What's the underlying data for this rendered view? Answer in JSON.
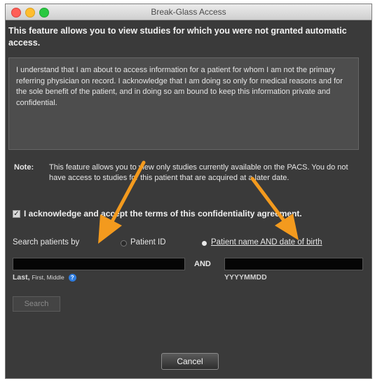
{
  "window": {
    "title": "Break-Glass Access"
  },
  "header": {
    "text": "This feature allows you to view studies for which you were not granted automatic access."
  },
  "agreement": {
    "text": "I understand that I am about to access information for a patient for whom I am not the primary referring physician on record. I acknowledge that I am doing so only for medical reasons and for the sole benefit of the patient, and in doing so am bound to keep this information private and confidential."
  },
  "note": {
    "label": "Note:",
    "text": "This feature allows you to view only studies currently available on the PACS. You do not have access to studies for this patient that are acquired at a later date."
  },
  "acknowledge": {
    "checked": true,
    "label": "I acknowledge and accept the terms of this confidentiality agreement."
  },
  "search_by": {
    "label": "Search patients by",
    "options": [
      {
        "label": "Patient ID",
        "selected": false
      },
      {
        "label": "Patient name AND date of birth",
        "selected": true
      }
    ]
  },
  "fields": {
    "name_value": "",
    "and_label": "AND",
    "dob_value": "",
    "name_hint_main": "Last,",
    "name_hint_small": "First, Middle",
    "help_glyph": "?",
    "dob_hint": "YYYYMMDD"
  },
  "buttons": {
    "search": "Search",
    "cancel": "Cancel"
  },
  "colors": {
    "annotation_arrow": "#f39a1e",
    "dialog_bg": "#3a3a3a"
  }
}
